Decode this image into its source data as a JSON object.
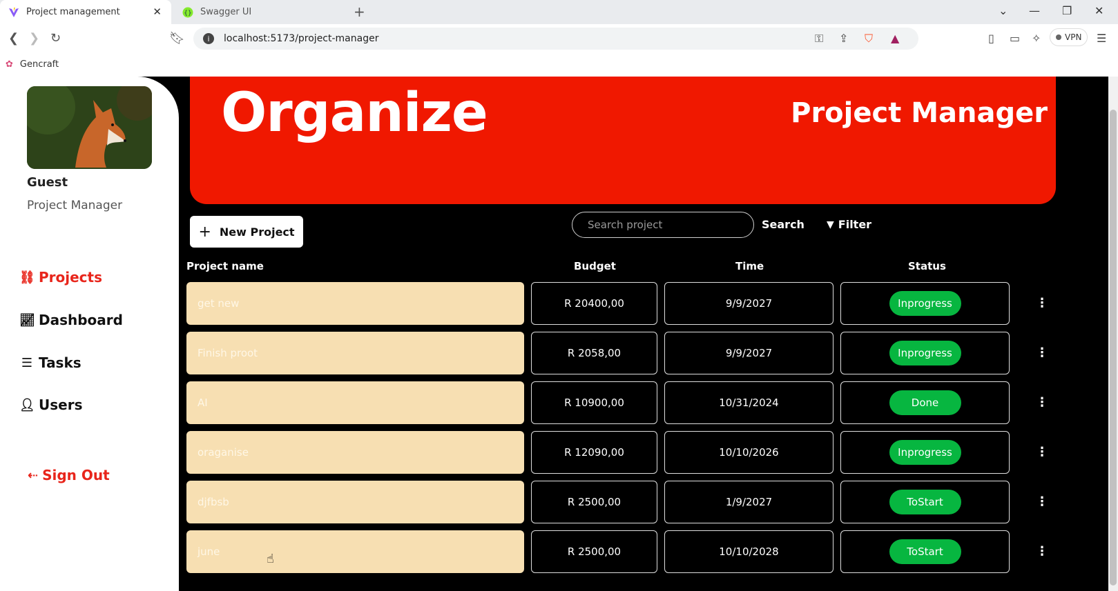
{
  "browser": {
    "tabs": [
      {
        "title": "Project management",
        "active": true,
        "icon": "vite-icon"
      },
      {
        "title": "Swagger UI",
        "active": false,
        "icon": "swagger-icon"
      }
    ],
    "url": "localhost:5173/project-manager",
    "vpn_label": "VPN",
    "bookmark": "Gencraft"
  },
  "sidebar": {
    "user_name": "Guest",
    "user_role": "Project Manager",
    "nav": [
      {
        "label": "Projects",
        "icon": "projects-icon",
        "active": true
      },
      {
        "label": "Dashboard",
        "icon": "chart-icon",
        "active": false
      },
      {
        "label": "Tasks",
        "icon": "tasks-icon",
        "active": false
      },
      {
        "label": "Users",
        "icon": "user-icon",
        "active": false
      }
    ],
    "signout": "Sign Out"
  },
  "banner": {
    "title": "Organize",
    "subtitle": "Project Manager"
  },
  "toolbar": {
    "new_project": "New Project",
    "search_placeholder": "Search project",
    "search_label": "Search",
    "filter_label": "Filter"
  },
  "table": {
    "headers": {
      "name": "Project name",
      "budget": "Budget",
      "time": "Time",
      "status": "Status"
    },
    "rows": [
      {
        "name": "get new",
        "budget": "R 20400,00",
        "time": "9/9/2027",
        "status": "Inprogress"
      },
      {
        "name": "Finish proot",
        "budget": "R 2058,00",
        "time": "9/9/2027",
        "status": "Inprogress"
      },
      {
        "name": "AI",
        "budget": "R 10900,00",
        "time": "10/31/2024",
        "status": "Done"
      },
      {
        "name": "oraganise",
        "budget": "R 12090,00",
        "time": "10/10/2026",
        "status": "Inprogress"
      },
      {
        "name": "djfbsb",
        "budget": "R 2500,00",
        "time": "1/9/2027",
        "status": "ToStart"
      },
      {
        "name": "june",
        "budget": "R 2500,00",
        "time": "10/10/2028",
        "status": "ToStart"
      }
    ]
  },
  "colors": {
    "accent": "#e8251b",
    "banner": "#f01800",
    "status_pill": "#07b640",
    "name_cell": "#f7dfb2"
  }
}
